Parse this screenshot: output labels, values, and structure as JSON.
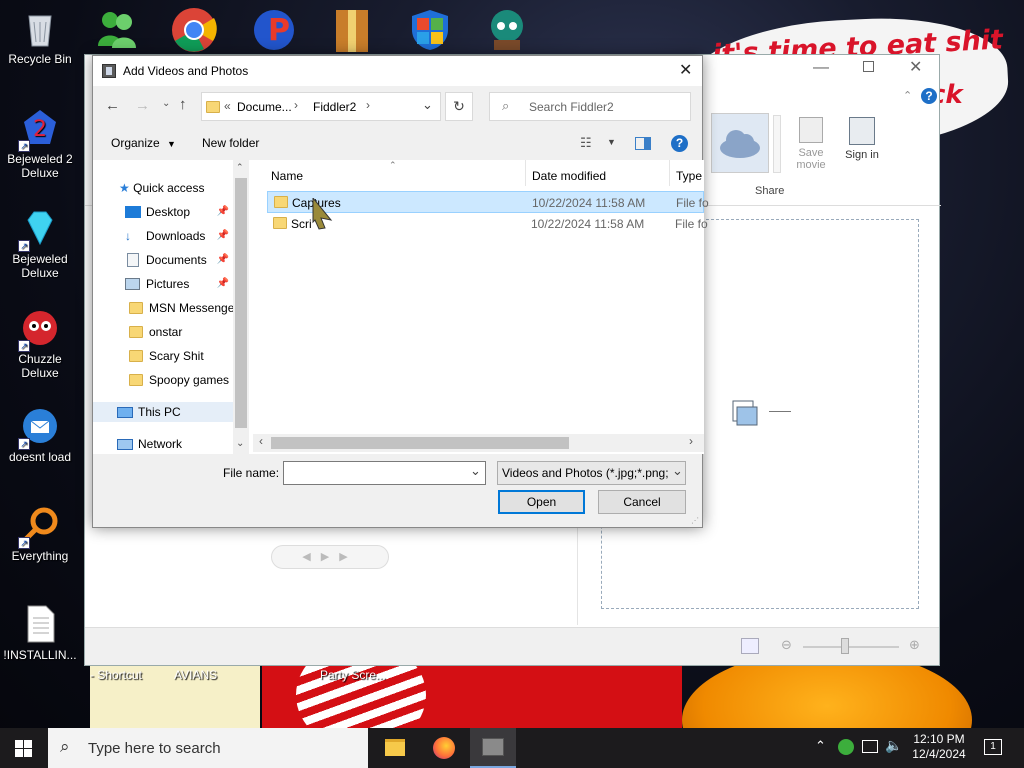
{
  "desktop": {
    "icons": [
      {
        "label": "Recycle Bin"
      },
      {
        "label": "Bejeweled 2 Deluxe"
      },
      {
        "label": "Bejeweled Deluxe"
      },
      {
        "label": "Chuzzle Deluxe"
      },
      {
        "label": "doesnt load"
      },
      {
        "label": "Everything"
      },
      {
        "label": "!INSTALLIN..."
      }
    ],
    "bottom_labels": [
      "- Shortcut",
      "AVIANS",
      "Party Scre..."
    ],
    "wallpaper_text": "it's time to eat shit",
    "wallpaper_text2": "ck"
  },
  "back_window": {
    "share_label": "Share",
    "save_movie_label": "Save movie",
    "sign_in_label": "Sign in"
  },
  "dialog": {
    "title": "Add Videos and Photos",
    "breadcrumb": [
      "Docume...",
      "Fiddler2"
    ],
    "breadcrumb_prefix": "«",
    "search_placeholder": "Search Fiddler2",
    "toolbar": {
      "organize": "Organize",
      "new_folder": "New folder"
    },
    "nav": {
      "quick_access": "Quick access",
      "items": [
        "Desktop",
        "Downloads",
        "Documents",
        "Pictures",
        "MSN Messenger",
        "onstar",
        "Scary Shit",
        "Spoopy games"
      ],
      "this_pc": "This PC",
      "network": "Network"
    },
    "columns": {
      "name": "Name",
      "date": "Date modified",
      "type": "Type"
    },
    "files": [
      {
        "name": "Captures",
        "date": "10/22/2024 11:58 AM",
        "type": "File fo"
      },
      {
        "name": "Scri",
        "date": "10/22/2024 11:58 AM",
        "type": "File fo"
      }
    ],
    "file_name_label": "File name:",
    "file_name_value": "",
    "filter": "Videos and Photos (*.jpg;*.png;",
    "open_label": "Open",
    "cancel_label": "Cancel"
  },
  "taskbar": {
    "search_placeholder": "Type here to search",
    "time": "12:10 PM",
    "date": "12/4/2024",
    "notification_count": "1"
  }
}
